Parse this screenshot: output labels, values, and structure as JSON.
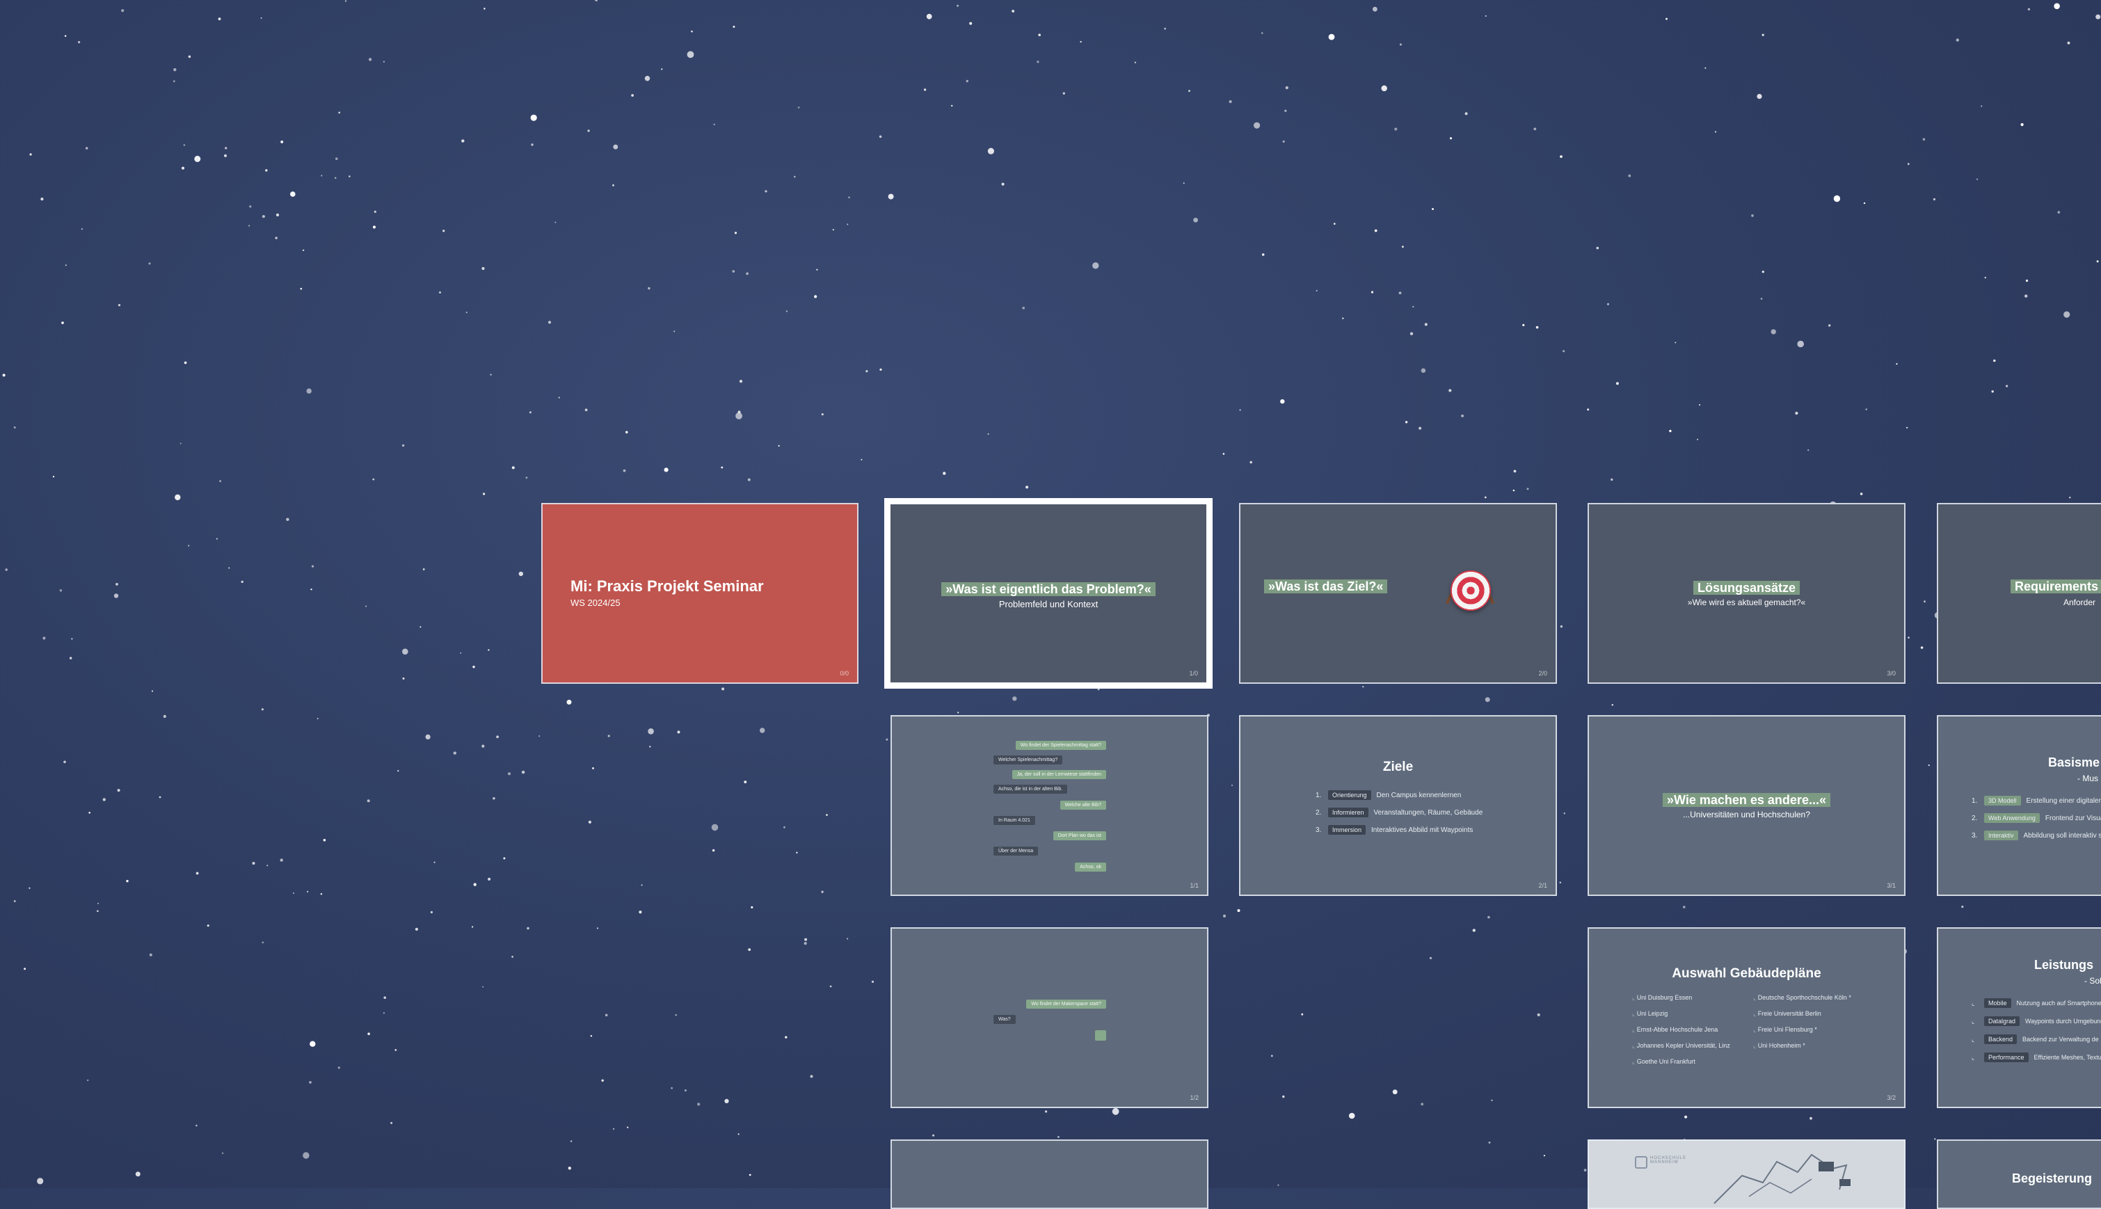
{
  "slides": {
    "title": {
      "heading": "Mi: Praxis Projekt Seminar",
      "sub": "WS 2024/25",
      "num": "0/0"
    },
    "problem": {
      "heading": "»Was ist eigentlich das Problem?«",
      "sub": "Problemfeld und Kontext",
      "num": "1/0"
    },
    "ziel": {
      "heading": "»Was ist das Ziel?«",
      "num": "2/0"
    },
    "loesung": {
      "heading": "Lösungsansätze",
      "sub": "»Wie wird es aktuell gemacht?«",
      "num": "3/0"
    },
    "requirements": {
      "heading": "Requirements",
      "sub": "Anforder"
    },
    "chat1": {
      "messages": [
        "Wo findet der Spielenachmittag statt?",
        "Welcher Spielenachmittag?",
        "Ja, der soll in der Lernwiese stattfinden",
        "Achso, die ist in der alten Bib.",
        "Welche alte Bib?",
        "In Raum 4.021",
        "Dort Plan wo das ist",
        "Über der Mensa",
        "Achso, ok"
      ],
      "num": "1/1"
    },
    "ziele": {
      "heading": "Ziele",
      "items": [
        {
          "n": "1.",
          "tag": "Orientierung",
          "text": "Den Campus kennenlernen"
        },
        {
          "n": "2.",
          "tag": "Informieren",
          "text": "Veranstaltungen, Räume, Gebäude"
        },
        {
          "n": "3.",
          "tag": "Immersion",
          "text": "Interaktives Abbild mit Waypoints"
        }
      ],
      "num": "2/1"
    },
    "andere": {
      "heading": "»Wie machen es andere...«",
      "sub": "...Universitäten und Hochschulen?",
      "num": "3/1"
    },
    "basis": {
      "heading": "Basisme",
      "sub": "- Mus",
      "items": [
        {
          "n": "1.",
          "tag": "3D Modell",
          "text": "Erstellung einer digitalen A"
        },
        {
          "n": "2.",
          "tag": "Web Anwendung",
          "text": "Frontend zur Visuali"
        },
        {
          "n": "3.",
          "tag": "Interaktiv",
          "text": "Abbildung soll interaktiv sein"
        }
      ]
    },
    "chat2": {
      "messages": [
        "Wo findet der Makerspace statt?",
        "Was?"
      ],
      "num": "1/2"
    },
    "gebaeude": {
      "heading": "Auswahl Gebäudepläne",
      "left": [
        "Uni Duisburg Essen",
        "Uni Leipzig",
        "Ernst-Abbe Hochschule Jena",
        "Johannes Kepler Universität, Linz",
        "Goethe Uni Frankfurt"
      ],
      "right": [
        "Deutsche Sporthochschule Köln *",
        "Freie Universität Berlin",
        "Freie Uni Flensburg *",
        "Uni Hohenheim *"
      ],
      "num": "3/2"
    },
    "leistung": {
      "heading": "Leistungs",
      "sub": "- Sol",
      "items": [
        {
          "tag": "Mobile",
          "text": "Nutzung auch auf Smartphone"
        },
        {
          "tag": "Datalgrad",
          "text": "Waypoints durch Umgebung"
        },
        {
          "tag": "Backend",
          "text": "Backend zur Verwaltung de"
        },
        {
          "tag": "Performance",
          "text": "Effiziente Meshes, Textu"
        }
      ]
    },
    "map": {
      "caption": "HOCHSCHULE MANNHEIM"
    },
    "begeisterung": {
      "heading": "Begeisterung"
    }
  }
}
